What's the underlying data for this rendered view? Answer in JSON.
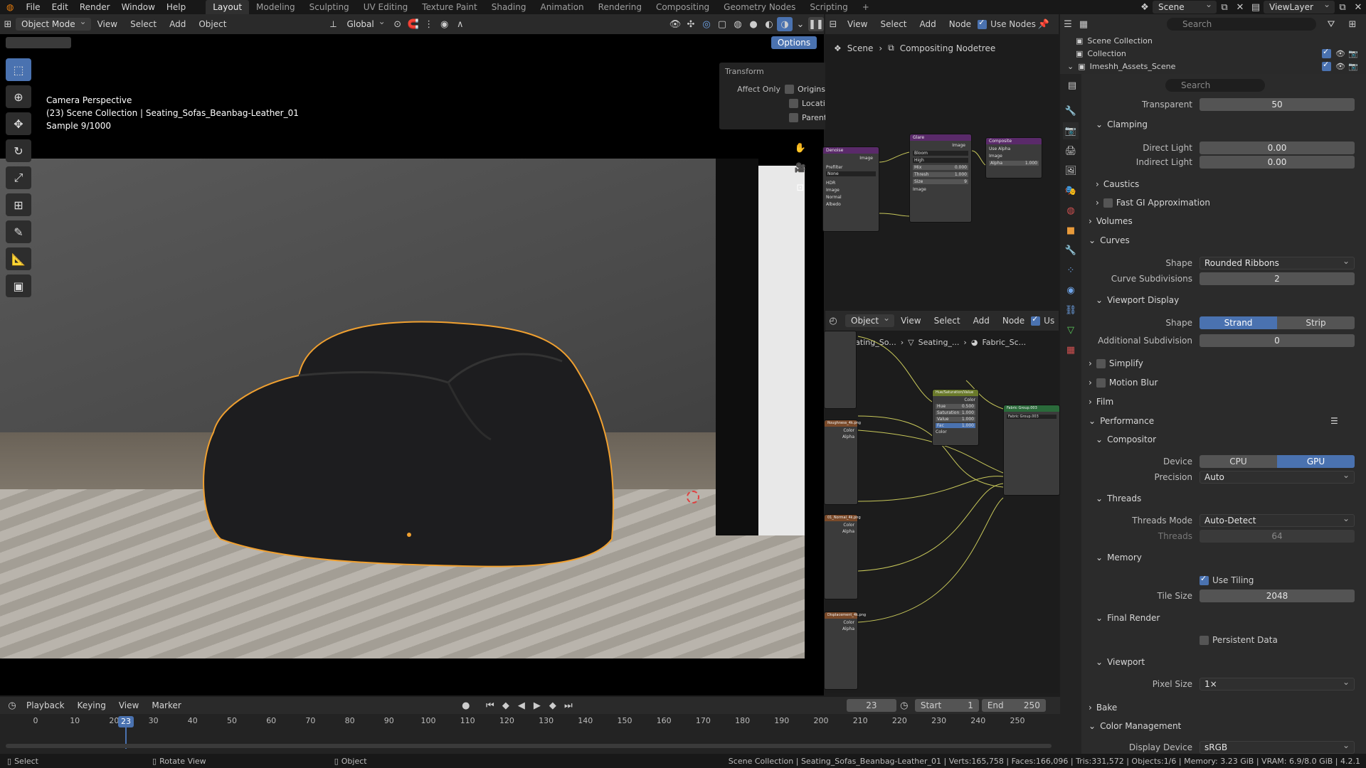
{
  "menu": [
    "File",
    "Edit",
    "Render",
    "Window",
    "Help"
  ],
  "workspaces": [
    "Layout",
    "Modeling",
    "Sculpting",
    "UV Editing",
    "Texture Paint",
    "Shading",
    "Animation",
    "Rendering",
    "Compositing",
    "Geometry Nodes",
    "Scripting"
  ],
  "topright": {
    "scene": "Scene",
    "search": "Search",
    "viewlayer": "ViewLayer"
  },
  "viewport_header": {
    "mode": "Object Mode",
    "view": "View",
    "select": "Select",
    "add": "Add",
    "object": "Object",
    "orientation": "Global",
    "options": "Options"
  },
  "viewport_info": {
    "line1": "Camera Perspective",
    "line2": "(23) Scene Collection | Seating_Sofas_Beanbag-Leather_01",
    "line3": "Sample 9/1000"
  },
  "transform_panel": {
    "title": "Transform",
    "affect_only": "Affect Only",
    "origins": "Origins",
    "locations": "Locations",
    "parents": "Parents"
  },
  "compositor_header": {
    "view": "View",
    "select": "Select",
    "add": "Add",
    "node": "Node",
    "use_nodes": "Use Nodes",
    "crumb1": "Scene",
    "crumb2": "Compositing Nodetree"
  },
  "compositor_nodes": {
    "denoise": "Denoise",
    "glare": "Glare",
    "composite": "Composite",
    "use_alpha": "Use Alpha",
    "image": "Image",
    "prefilter": "Prefilter",
    "none": "None",
    "hdr": "HDR",
    "normal": "Normal",
    "albedo": "Albedo",
    "bloom": "Bloom",
    "high": "High",
    "mix": "Mix",
    "mix_val": "0.000",
    "thresh": "Thresh",
    "thresh_val": "1.000",
    "size": "Size",
    "size_val": "9",
    "alpha": "Alpha",
    "alpha_val": "1.000"
  },
  "shader_header": {
    "object": "Object",
    "view": "View",
    "select": "Select",
    "add": "Add",
    "node": "Node",
    "use": "Us",
    "crumb1": "Seating_So...",
    "crumb2": "Seating_...",
    "crumb3": "Fabric_Sc..."
  },
  "shader_nodes": {
    "hue": "Hue/Saturation/Value",
    "fabric": "Fabric Group.003",
    "fabric2": "Fabric Group.003",
    "roughness": "Roughness_4k.png",
    "normalmap": "01_Normal_4k.png",
    "displacement": "Displacement_4k.png",
    "color": "Color",
    "alpha": "Alpha",
    "hue_v": "Hue",
    "sat_v": "Saturation",
    "val_v": "Value",
    "fac_v": "Fac",
    "n05": "0.500",
    "n1": "1.000"
  },
  "outliner": {
    "search": "Search",
    "items": [
      "Scene Collection",
      "Collection",
      "Imeshh_Assets_Scene"
    ]
  },
  "properties": {
    "search": "Search",
    "transparent_label": "Transparent",
    "transparent_val": "50",
    "clamping": "Clamping",
    "direct": "Direct Light",
    "direct_val": "0.00",
    "indirect": "Indirect Light",
    "indirect_val": "0.00",
    "caustics": "Caustics",
    "fastgi": "Fast GI Approximation",
    "volumes": "Volumes",
    "curves": "Curves",
    "shape_label": "Shape",
    "shape_val": "Rounded Ribbons",
    "curve_sub": "Curve Subdivisions",
    "curve_sub_val": "2",
    "viewport_display": "Viewport Display",
    "vshape": "Shape",
    "strand": "Strand",
    "strip": "Strip",
    "add_sub": "Additional Subdivision",
    "add_sub_val": "0",
    "simplify": "Simplify",
    "motion_blur": "Motion Blur",
    "film": "Film",
    "performance": "Performance",
    "compositor": "Compositor",
    "device": "Device",
    "cpu": "CPU",
    "gpu": "GPU",
    "precision": "Precision",
    "precision_val": "Auto",
    "threads": "Threads",
    "threads_mode": "Threads Mode",
    "threads_mode_val": "Auto-Detect",
    "threads_label": "Threads",
    "threads_val": "64",
    "memory": "Memory",
    "use_tiling": "Use Tiling",
    "tile_size": "Tile Size",
    "tile_size_val": "2048",
    "final_render": "Final Render",
    "persistent": "Persistent Data",
    "viewport": "Viewport",
    "pixel_size": "Pixel Size",
    "pixel_size_val": "1×",
    "bake": "Bake",
    "color_mgmt": "Color Management",
    "display_device": "Display Device",
    "display_device_val": "sRGB"
  },
  "timeline": {
    "playback": "Playback",
    "keying": "Keying",
    "view": "View",
    "marker": "Marker",
    "current": "23",
    "start_label": "Start",
    "start": "1",
    "end_label": "End",
    "end": "250",
    "frame_marker": "23",
    "ticks": [
      "0",
      "10",
      "20",
      "30",
      "40",
      "50",
      "60",
      "70",
      "80",
      "90",
      "100",
      "110",
      "120",
      "130",
      "140",
      "150",
      "160",
      "170",
      "180",
      "190",
      "200",
      "210",
      "220",
      "230",
      "240",
      "250"
    ]
  },
  "status": {
    "select": "Select",
    "rotate": "Rotate View",
    "object": "Object",
    "stats": "Scene Collection | Seating_Sofas_Beanbag-Leather_01 | Verts:165,758 | Faces:166,096 | Tris:331,572 | Objects:1/6 | Memory: 3.23 GiB | VRAM: 6.9/8.0 GiB | 4.2.1"
  },
  "colors": {
    "accent": "#4a72b0",
    "selection": "#f0a030"
  }
}
